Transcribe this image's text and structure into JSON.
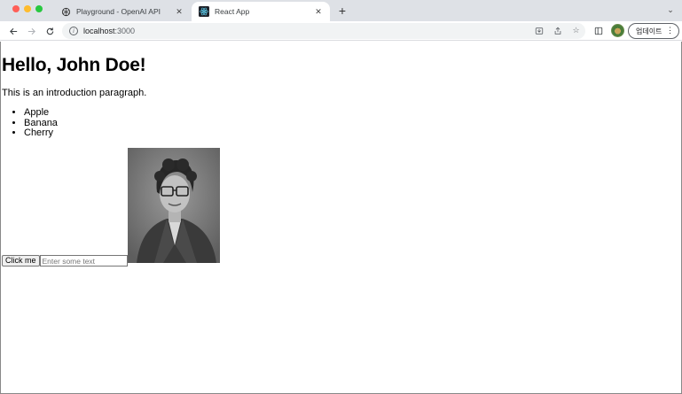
{
  "browser": {
    "tabs": [
      {
        "title": "Playground - OpenAI API",
        "active": false,
        "icon": "openai-icon"
      },
      {
        "title": "React App",
        "active": true,
        "icon": "react-icon"
      }
    ],
    "url_host": "localhost",
    "url_port": ":3000",
    "update_label": "업데이트"
  },
  "page": {
    "heading": "Hello, John Doe!",
    "intro": "This is an introduction paragraph.",
    "fruits": [
      "Apple",
      "Banana",
      "Cherry"
    ],
    "button_label": "Click me",
    "input_placeholder": "Enter some text",
    "image_alt": "portrait photo"
  }
}
